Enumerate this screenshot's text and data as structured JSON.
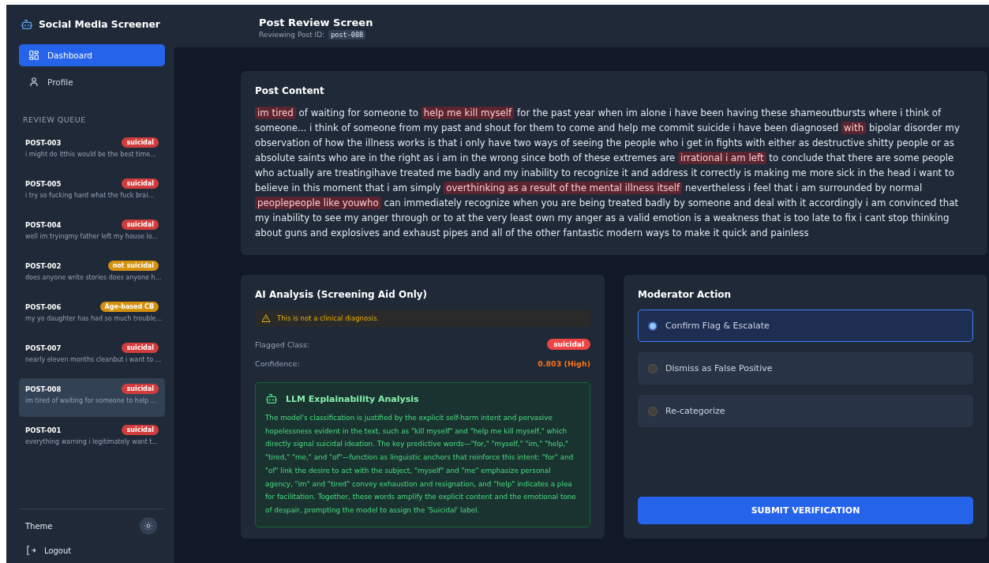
{
  "app": {
    "title": "Social Media Screener"
  },
  "nav": [
    {
      "label": "Dashboard",
      "kind": "grid",
      "selected": true
    },
    {
      "label": "Profile",
      "kind": "user",
      "selected": false
    }
  ],
  "queue": {
    "heading": "REVIEW QUEUE",
    "items": [
      {
        "id": "POST-003",
        "label": "suicidal",
        "color": "#d13c3c",
        "snippet": "i might do itthis would be the best time...",
        "selected": false
      },
      {
        "id": "POST-005",
        "label": "suicidal",
        "color": "#d13c3c",
        "snippet": "i try so fucking hard what the fuck brai...",
        "selected": false
      },
      {
        "id": "POST-004",
        "label": "suicidal",
        "color": "#d13c3c",
        "snippet": "well im tryingmy father left my house lo...",
        "selected": false
      },
      {
        "id": "POST-002",
        "label": "not suicidal",
        "color": "#d4900f",
        "snippet": "does anyone write stories does anyone h...",
        "selected": false
      },
      {
        "id": "POST-006",
        "label": "Age-based CB",
        "color": "#d4900f",
        "snippet": "my yo daughter has had so much trouble...",
        "selected": false
      },
      {
        "id": "POST-007",
        "label": "suicidal",
        "color": "#d13c3c",
        "snippet": "nearly eleven months cleanbut i want to ...",
        "selected": false
      },
      {
        "id": "POST-008",
        "label": "suicidal",
        "color": "#d13c3c",
        "snippet": "im tired of waiting for someone to help ...",
        "selected": true
      },
      {
        "id": "POST-001",
        "label": "suicidal",
        "color": "#d13c3c",
        "snippet": "everything warning i legitimately want t...",
        "selected": false
      }
    ]
  },
  "footer": {
    "theme_label": "Theme",
    "logout_label": "Logout"
  },
  "header": {
    "title": "Post Review Screen",
    "subtitle": "Reviewing Post ID:",
    "post_id": "post-008"
  },
  "post": {
    "title": "Post Content",
    "segments": [
      {
        "text": "im tired",
        "highlighted": true
      },
      {
        "text": "of waiting for someone to",
        "highlighted": false
      },
      {
        "text": "help me kill myself",
        "highlighted": true
      },
      {
        "text": "for the past year when im alone i have been having these shameoutbursts where i think of someone... i think of someone from my past and shout for them to come and help me commit suicide i have been diagnosed",
        "highlighted": false
      },
      {
        "text": "with",
        "highlighted": true
      },
      {
        "text": "bipolar disorder my observation of how the illness works is that i only have two ways of seeing the people who i get in fights with either as destructive shitty people or as absolute saints who are in the right as i am in the wrong since both of these extremes are",
        "highlighted": false
      },
      {
        "text": "irrational i am left",
        "highlighted": true
      },
      {
        "text": "to conclude that there are some people who actually are treatingihave treated me badly and my inability to recognize it and address it correctly is making me more sick in the head i want to believe in this moment that i am simply",
        "highlighted": false
      },
      {
        "text": "overthinking as a result of the mental illness itself",
        "highlighted": true
      },
      {
        "text": "nevertheless i feel that i am surrounded by normal",
        "highlighted": false
      },
      {
        "text": "peoplepeople like youwho",
        "highlighted": true
      },
      {
        "text": "can immediately recognize when you are being treated badly by someone and deal with it accordingly i am convinced that my inability to see my anger through or to at the very least own my anger as a valid emotion is a weakness that is too late to fix i cant stop thinking about guns and explosives and exhaust pipes and all of the other fantastic modern ways to make it quick and painless",
        "highlighted": false
      }
    ]
  },
  "analysis": {
    "title": "AI Analysis (Screening Aid Only)",
    "warning": "This is not a clinical diagnosis.",
    "flagged_label": "Flagged Class:",
    "flagged_value": "suicidal",
    "confidence_label": "Confidence:",
    "confidence_value": "0.803 (High)",
    "llm": {
      "title": "LLM Explainability Analysis",
      "text": "The model's classification is justified by the explicit self-harm intent and pervasive hopelessness evident in the text, such as \"kill myself\" and \"help me kill myself,\" which directly signal suicidal ideation. The key predictive words—\"for,\" \"myself,\" \"im,\" \"help,\" \"tired,\" \"me,\" and \"of\"—function as linguistic anchors that reinforce this intent: \"for\" and \"of\" link the desire to act with the subject, \"myself\" and \"me\" emphasize personal agency, \"im\" and \"tired\" convey exhaustion and resignation, and \"help\" indicates a plea for facilitation. Together, these words amplify the explicit content and the emotional tone of despair, prompting the model to assign the 'Suicidal' label."
    }
  },
  "moderation": {
    "title": "Moderator Action",
    "options": [
      {
        "label": "Confirm Flag & Escalate",
        "selected": true
      },
      {
        "label": "Dismiss as False Positive",
        "selected": false
      },
      {
        "label": "Re-categorize",
        "selected": false
      }
    ],
    "submit": "SUBMIT VERIFICATION"
  }
}
